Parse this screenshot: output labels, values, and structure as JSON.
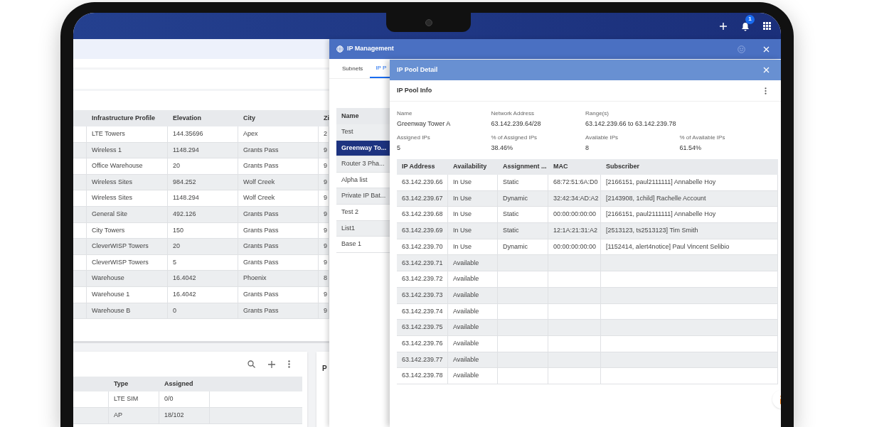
{
  "header": {
    "notification_count": "1"
  },
  "profiles_table": {
    "columns": [
      "Infrastructure Profile",
      "Elevation",
      "City",
      "Zi"
    ],
    "rows": [
      [
        "LTE Towers",
        "144.35696",
        "Apex",
        "2"
      ],
      [
        "Wireless 1",
        "1148.294",
        "Grants Pass",
        "9"
      ],
      [
        "Office Warehouse",
        "20",
        "Grants Pass",
        "9"
      ],
      [
        "Wireless Sites",
        "984.252",
        "Wolf Creek",
        "9"
      ],
      [
        "Wireless Sites",
        "1148.294",
        "Wolf Creek",
        "9"
      ],
      [
        "General Site",
        "492.126",
        "Grants Pass",
        "9"
      ],
      [
        "City Towers",
        "150",
        "Grants Pass",
        "9"
      ],
      [
        "CleverWISP Towers",
        "20",
        "Grants Pass",
        "9"
      ],
      [
        "CleverWISP Towers",
        "5",
        "Grants Pass",
        "9"
      ],
      [
        "Warehouse",
        "16.4042",
        "Phoenix",
        "8"
      ],
      [
        "Warehouse 1",
        "16.4042",
        "Grants Pass",
        "9"
      ],
      [
        "Warehouse B",
        "0",
        "Grants Pass",
        "9"
      ]
    ]
  },
  "devices_card": {
    "columns": [
      "Type",
      "Assigned"
    ],
    "rows": [
      [
        "LTE SIM",
        "0/0"
      ],
      [
        "AP",
        "18/102"
      ]
    ]
  },
  "side_card": {
    "title": "P"
  },
  "ip_management": {
    "title": "IP Management",
    "tabs": [
      {
        "label": "Subnets",
        "selected": false
      },
      {
        "label": "IP P",
        "selected": true
      }
    ],
    "pools": {
      "column": "Name",
      "items": [
        {
          "label": "Test",
          "selected": false
        },
        {
          "label": "Greenway To...",
          "selected": true
        },
        {
          "label": "Router 3 Pha...",
          "selected": false
        },
        {
          "label": "Alpha list",
          "selected": false
        },
        {
          "label": "Private IP Bat...",
          "selected": false
        },
        {
          "label": "Test 2",
          "selected": false
        },
        {
          "label": "List1",
          "selected": false
        },
        {
          "label": "Base 1",
          "selected": false
        }
      ]
    }
  },
  "ip_pool_detail": {
    "title": "IP Pool Detail",
    "section": "IP Pool Info",
    "fields": [
      {
        "label": "Name",
        "value": "Greenway Tower A"
      },
      {
        "label": "Network Address",
        "value": "63.142.239.64/28"
      },
      {
        "label": "Range(s)",
        "value": "63.142.239.66 to 63.142.239.78"
      },
      {
        "label": "Assigned IPs",
        "value": "5"
      },
      {
        "label": "% of Assigned IPs",
        "value": "38.46%"
      },
      {
        "label": "Available IPs",
        "value": "8"
      },
      {
        "label": "% of Available IPs",
        "value": "61.54%"
      }
    ],
    "table": {
      "columns": [
        "IP Address",
        "Availability",
        "Assignment ...",
        "MAC",
        "Subscriber"
      ],
      "rows": [
        {
          "ip": "63.142.239.66",
          "availability": "In Use",
          "assignment": "Static",
          "mac": "68:72:51:6A:D0",
          "subscriber": "[2166151, paul2111111] Annabelle Hoy"
        },
        {
          "ip": "63.142.239.67",
          "availability": "In Use",
          "assignment": "Dynamic",
          "mac": "32:42:34:AD:A2",
          "subscriber": "[2143908, 1child] Rachelle Account"
        },
        {
          "ip": "63.142.239.68",
          "availability": "In Use",
          "assignment": "Static",
          "mac": "00:00:00:00:00",
          "subscriber": "[2166151, paul2111111] Annabelle Hoy"
        },
        {
          "ip": "63.142.239.69",
          "availability": "In Use",
          "assignment": "Static",
          "mac": "12:1A:21:31:A2",
          "subscriber": "[2513123, ts2513123] Tim Smith"
        },
        {
          "ip": "63.142.239.70",
          "availability": "In Use",
          "assignment": "Dynamic",
          "mac": "00:00:00:00:00",
          "subscriber": "[1152414, alert4notice] Paul Vincent Selibio"
        },
        {
          "ip": "63.142.239.71",
          "availability": "Available"
        },
        {
          "ip": "63.142.239.72",
          "availability": "Available"
        },
        {
          "ip": "63.142.239.73",
          "availability": "Available"
        },
        {
          "ip": "63.142.239.74",
          "availability": "Available"
        },
        {
          "ip": "63.142.239.75",
          "availability": "Available"
        },
        {
          "ip": "63.142.239.76",
          "availability": "Available"
        },
        {
          "ip": "63.142.239.77",
          "availability": "Available"
        },
        {
          "ip": "63.142.239.78",
          "availability": "Available"
        }
      ]
    }
  }
}
